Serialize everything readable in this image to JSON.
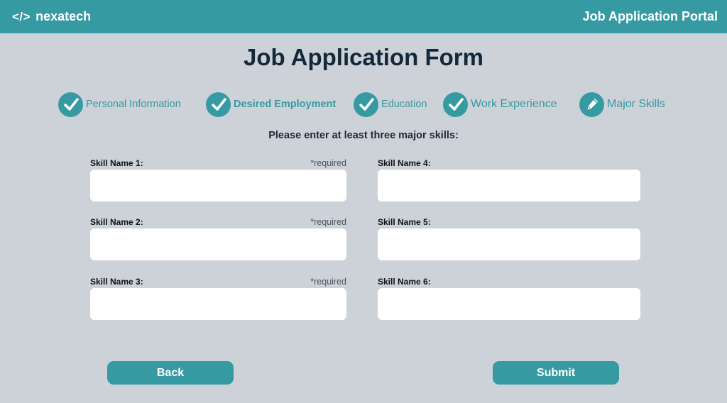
{
  "header": {
    "brand_icon": "</>",
    "brand_name": "nexatech",
    "portal_title": "Job Application Portal"
  },
  "form": {
    "title": "Job Application Form",
    "instructions": "Please enter at least three major skills:"
  },
  "steps": [
    {
      "label": "Personal Information",
      "icon": "check-icon",
      "status": "complete"
    },
    {
      "label": "Desired Employment",
      "icon": "check-icon",
      "status": "complete"
    },
    {
      "label": "Education",
      "icon": "check-icon",
      "status": "complete"
    },
    {
      "label": "Work Experience",
      "icon": "check-icon",
      "status": "complete"
    },
    {
      "label": "Major Skills",
      "icon": "pencil-icon",
      "status": "current"
    }
  ],
  "fields": [
    {
      "label": "Skill Name 1:",
      "required_text": "*required",
      "value": ""
    },
    {
      "label": "Skill Name 2:",
      "required_text": "*required",
      "value": ""
    },
    {
      "label": "Skill Name 3:",
      "required_text": "*required",
      "value": ""
    },
    {
      "label": "Skill Name 4:",
      "required_text": "",
      "value": ""
    },
    {
      "label": "Skill Name 5:",
      "required_text": "",
      "value": ""
    },
    {
      "label": "Skill Name 6:",
      "required_text": "",
      "value": ""
    }
  ],
  "buttons": {
    "back_label": "Back",
    "submit_label": "Submit"
  },
  "colors": {
    "accent": "#369aa3",
    "background": "#ccd2d8",
    "title": "#13283a"
  }
}
